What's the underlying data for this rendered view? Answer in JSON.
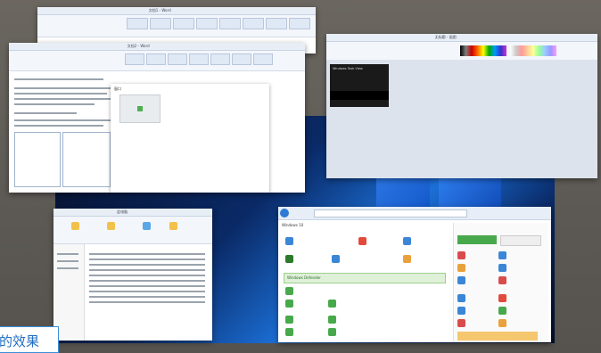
{
  "caption": {
    "text": "的效果"
  },
  "word_top": {
    "title": "文档1 - Word"
  },
  "word_main": {
    "title": "文档2 - Word",
    "dialog_title": "窗口"
  },
  "paint": {
    "title": "无标题 - 画图",
    "video_title": "Windows Task View"
  },
  "explorer": {
    "title": "此电脑"
  },
  "browser": {
    "title": "Windows 10",
    "banner": "Windows Defender",
    "sidebar_heading": "相关推荐"
  },
  "colors": {
    "accent": "#1f6fc5",
    "green": "#48a94c"
  }
}
